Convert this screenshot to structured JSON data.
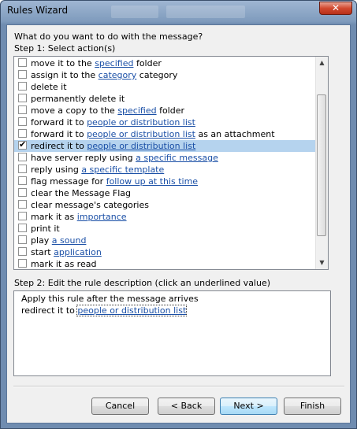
{
  "window": {
    "title": "Rules Wizard",
    "close_glyph": "✕"
  },
  "prompt": "What do you want to do with the message?",
  "step1": {
    "label": "Step 1: Select action(s)",
    "actions": [
      {
        "pre": "move it to the ",
        "link": "specified",
        "post": " folder",
        "checked": false
      },
      {
        "pre": "assign it to the ",
        "link": "category",
        "post": " category",
        "checked": false
      },
      {
        "pre": "delete it",
        "link": "",
        "post": "",
        "checked": false
      },
      {
        "pre": "permanently delete it",
        "link": "",
        "post": "",
        "checked": false
      },
      {
        "pre": "move a copy to the ",
        "link": "specified",
        "post": " folder",
        "checked": false
      },
      {
        "pre": "forward it to ",
        "link": "people or distribution list",
        "post": "",
        "checked": false
      },
      {
        "pre": "forward it to ",
        "link": "people or distribution list",
        "post": " as an attachment",
        "checked": false
      },
      {
        "pre": "redirect it to ",
        "link": "people or distribution list",
        "post": "",
        "checked": true
      },
      {
        "pre": "have server reply using ",
        "link": "a specific message",
        "post": "",
        "checked": false
      },
      {
        "pre": "reply using ",
        "link": "a specific template",
        "post": "",
        "checked": false
      },
      {
        "pre": "flag message for ",
        "link": "follow up at this time",
        "post": "",
        "checked": false
      },
      {
        "pre": "clear the Message Flag",
        "link": "",
        "post": "",
        "checked": false
      },
      {
        "pre": "clear message's categories",
        "link": "",
        "post": "",
        "checked": false
      },
      {
        "pre": "mark it as ",
        "link": "importance",
        "post": "",
        "checked": false
      },
      {
        "pre": "print it",
        "link": "",
        "post": "",
        "checked": false
      },
      {
        "pre": "play ",
        "link": "a sound",
        "post": "",
        "checked": false
      },
      {
        "pre": "start ",
        "link": "application",
        "post": "",
        "checked": false
      },
      {
        "pre": "mark it as read",
        "link": "",
        "post": "",
        "checked": false
      }
    ],
    "selected_index": 7
  },
  "step2": {
    "label": "Step 2: Edit the rule description (click an underlined value)",
    "line1": "Apply this rule after the message arrives",
    "line2_pre": "redirect it to ",
    "line2_link": "people or distribution list"
  },
  "buttons": {
    "cancel": "Cancel",
    "back": "< Back",
    "next": "Next >",
    "finish": "Finish"
  },
  "scrollbar": {
    "up_glyph": "▲",
    "down_glyph": "▼"
  }
}
